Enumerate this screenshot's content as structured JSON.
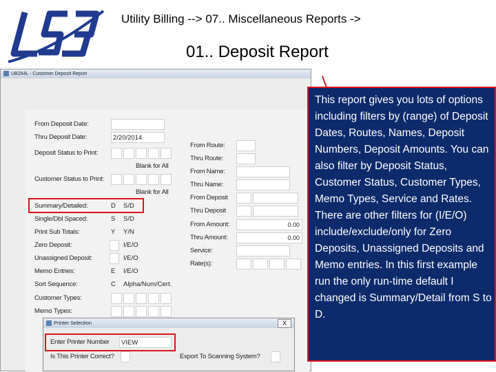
{
  "header": {
    "breadcrumb": "Utility Billing -->   07.. Miscellaneous Reports ->",
    "title": "01.. Deposit Report"
  },
  "window": {
    "title": "UB264L - Customer Deposit Report"
  },
  "form": {
    "from_deposit_date": "From Deposit Date:",
    "thru_deposit_date": "Thru Deposit Date:",
    "thru_deposit_date_value": "2/20/2014",
    "deposit_status": "Deposit Status to Print:",
    "blank_for_all_1": "Blank for All",
    "customer_status": "Customer Status to Print:",
    "blank_for_all_2": "Blank for All",
    "summary_detailed": "Summary/Detailed:",
    "summary_detailed_value": "D",
    "summary_detailed_opts": "S/D",
    "single_dbl": "Single/Dbl Spaced:",
    "single_dbl_value": "S",
    "single_dbl_opts": "S/D",
    "print_sub_totals": "Print Sub Totals:",
    "print_sub_totals_value": "Y",
    "print_sub_totals_opts": "Y/N",
    "zero_deposit": "Zero Deposit:",
    "zero_deposit_opts": "I/E/O",
    "unassigned_deposit": "Unassigned Deposit:",
    "unassigned_deposit_opts": "I/E/O",
    "memo_entries": "Memo Entries:",
    "memo_entries_value": "E",
    "memo_entries_opts": "I/E/O",
    "sort_sequence": "Sort Sequence:",
    "sort_sequence_value": "C",
    "sort_sequence_opts": "Alpha/Num/Cert.",
    "customer_types": "Customer Types:",
    "memo_types": "Memo Types:",
    "from_route": "From Route:",
    "thru_route": "Thru Route:",
    "from_name": "From Name:",
    "thru_name": "Thru Name:",
    "from_deposit": "From Deposit",
    "thru_deposit": "Thru Deposit",
    "from_amount": "From Amount:",
    "from_amount_value": "0.00",
    "thru_amount": "Thru Amount:",
    "thru_amount_value": "0.00",
    "service": "Service:",
    "rates": "Rate(s):"
  },
  "printer_dialog": {
    "title": "Printer Selection",
    "close": "X",
    "enter_printer": "Enter Printer Number",
    "printer_value": "VIEW",
    "is_correct": "Is This Printer Correct?",
    "export": "Export To Scanning System?"
  },
  "callout": {
    "text": "This report gives you lots of options including filters by (range) of Deposit Dates, Routes, Names, Deposit Numbers, Deposit Amounts. You can also filter by Deposit Status, Customer Status, Customer Types, Memo Types, Service and Rates. There are other filters for (I/E/O) include/exclude/only for Zero Deposits, Unassigned Deposits and Memo entries.  In this first example run the only run-time default I changed is Summary/Detail from S to D."
  },
  "colors": {
    "accent_red": "#d9141b",
    "callout_bg": "#0d2a6b",
    "logo_blue": "#1f3a8f"
  },
  "icons": {
    "logo": "lsi-logo",
    "window": "window-icon"
  }
}
